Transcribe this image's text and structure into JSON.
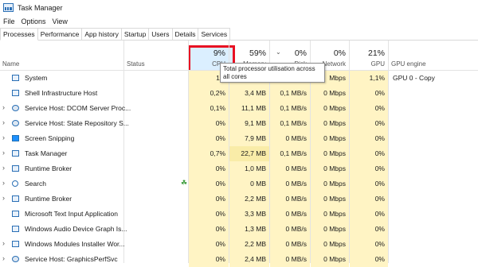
{
  "window": {
    "title": "Task Manager"
  },
  "menu": [
    "File",
    "Options",
    "View"
  ],
  "tabs": [
    "Processes",
    "Performance",
    "App history",
    "Startup",
    "Users",
    "Details",
    "Services"
  ],
  "active_tab": "Processes",
  "columns": {
    "name": "Name",
    "status": "Status",
    "cpu": {
      "pct": "9%",
      "label": "CPU"
    },
    "memory": {
      "pct": "59%",
      "label": "Memory"
    },
    "disk": {
      "pct": "0%",
      "label": "Disk"
    },
    "network": {
      "pct": "0%",
      "label": "Network"
    },
    "gpu": {
      "pct": "21%",
      "label": "GPU"
    },
    "gpu_engine": "GPU engine"
  },
  "tooltip": "Total processor utilisation across all cores",
  "processes": [
    {
      "name": "System",
      "cpu": "1,7",
      "memory": "",
      "disk": "",
      "network": "Mbps",
      "gpu": "1,1%",
      "gpu_engine": "GPU 0 - Copy",
      "expandable": false,
      "icon": "system-icon"
    },
    {
      "name": "Shell Infrastructure Host",
      "cpu": "0,2%",
      "memory": "3,4 MB",
      "disk": "0,1 MB/s",
      "network": "0 Mbps",
      "gpu": "0%",
      "gpu_engine": "",
      "expandable": false,
      "icon": "app-icon"
    },
    {
      "name": "Service Host: DCOM Server Proc...",
      "cpu": "0,1%",
      "memory": "11,1 MB",
      "disk": "0,1 MB/s",
      "network": "0 Mbps",
      "gpu": "0%",
      "gpu_engine": "",
      "expandable": true,
      "icon": "gear-icon"
    },
    {
      "name": "Service Host: State Repository S...",
      "cpu": "0%",
      "memory": "9,1 MB",
      "disk": "0,1 MB/s",
      "network": "0 Mbps",
      "gpu": "0%",
      "gpu_engine": "",
      "expandable": true,
      "icon": "gear-icon"
    },
    {
      "name": "Screen Snipping",
      "cpu": "0%",
      "memory": "7,9 MB",
      "disk": "0 MB/s",
      "network": "0 Mbps",
      "gpu": "0%",
      "gpu_engine": "",
      "expandable": true,
      "icon": "snipping-icon"
    },
    {
      "name": "Task Manager",
      "cpu": "0,7%",
      "memory": "22,7 MB",
      "disk": "0,1 MB/s",
      "network": "0 Mbps",
      "gpu": "0%",
      "gpu_engine": "",
      "expandable": true,
      "icon": "task-manager-icon"
    },
    {
      "name": "Runtime Broker",
      "cpu": "0%",
      "memory": "1,0 MB",
      "disk": "0 MB/s",
      "network": "0 Mbps",
      "gpu": "0%",
      "gpu_engine": "",
      "expandable": true,
      "icon": "app-icon"
    },
    {
      "name": "Search",
      "cpu": "0%",
      "memory": "0 MB",
      "disk": "0 MB/s",
      "network": "0 Mbps",
      "gpu": "0%",
      "gpu_engine": "",
      "expandable": true,
      "icon": "search-icon",
      "status_icon": "leaf-icon"
    },
    {
      "name": "Runtime Broker",
      "cpu": "0%",
      "memory": "2,2 MB",
      "disk": "0 MB/s",
      "network": "0 Mbps",
      "gpu": "0%",
      "gpu_engine": "",
      "expandable": true,
      "icon": "app-icon"
    },
    {
      "name": "Microsoft Text Input Application",
      "cpu": "0%",
      "memory": "3,3 MB",
      "disk": "0 MB/s",
      "network": "0 Mbps",
      "gpu": "0%",
      "gpu_engine": "",
      "expandable": false,
      "icon": "app-icon"
    },
    {
      "name": "Windows Audio Device Graph Is...",
      "cpu": "0%",
      "memory": "1,3 MB",
      "disk": "0 MB/s",
      "network": "0 Mbps",
      "gpu": "0%",
      "gpu_engine": "",
      "expandable": false,
      "icon": "app-icon"
    },
    {
      "name": "Windows Modules Installer Wor...",
      "cpu": "0%",
      "memory": "2,2 MB",
      "disk": "0 MB/s",
      "network": "0 Mbps",
      "gpu": "0%",
      "gpu_engine": "",
      "expandable": true,
      "icon": "app-icon"
    },
    {
      "name": "Service Host: GraphicsPerfSvc",
      "cpu": "0%",
      "memory": "2,4 MB",
      "disk": "0 MB/s",
      "network": "0 Mbps",
      "gpu": "0%",
      "gpu_engine": "",
      "expandable": true,
      "icon": "gear-icon"
    }
  ],
  "colors": {
    "heat_light": "#fff4c4",
    "heat_mid": "#f9eca8",
    "highlight_border": "#e81123",
    "cpu_header_fill": "#cce8ff"
  }
}
